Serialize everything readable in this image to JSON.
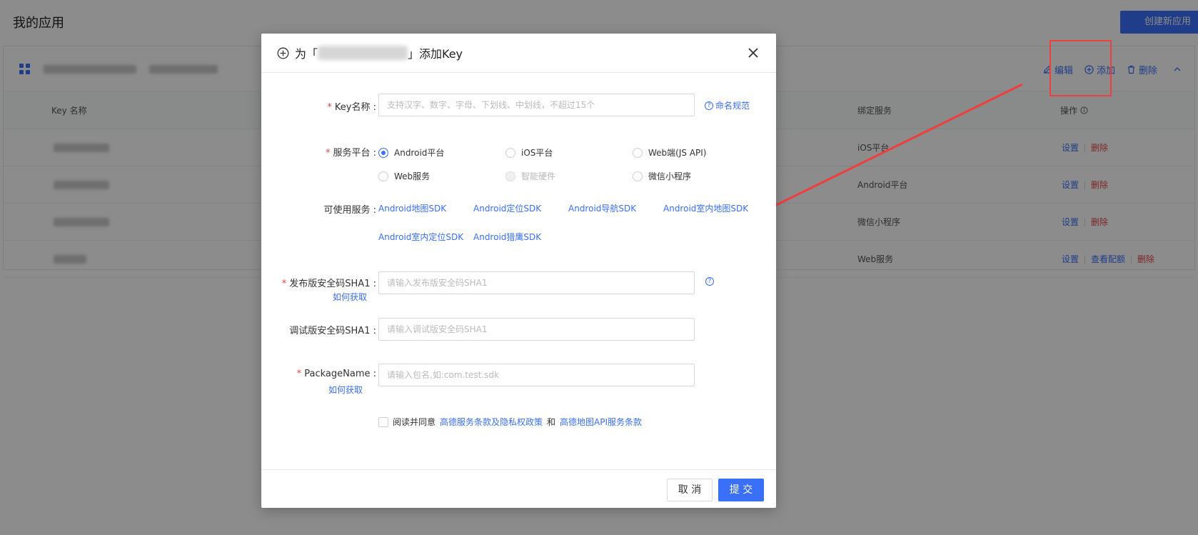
{
  "page": {
    "title": "我的应用",
    "create_button": "创建新应用",
    "app_actions": {
      "edit": "编辑",
      "add": "添加",
      "delete": "删除"
    },
    "table": {
      "headers": {
        "key_name": "Key 名称",
        "bound_service": "绑定服务",
        "operation": "操作"
      },
      "rows": [
        {
          "service": "iOS平台",
          "actions": [
            "设置",
            "删除"
          ]
        },
        {
          "service": "Android平台",
          "actions": [
            "设置",
            "删除"
          ]
        },
        {
          "service": "微信小程序",
          "actions": [
            "设置",
            "删除"
          ]
        },
        {
          "service": "Web服务",
          "actions": [
            "设置",
            "查看配额",
            "删除"
          ]
        }
      ]
    }
  },
  "modal": {
    "title_prefix": "为「",
    "title_suffix": "」添加Key",
    "key_name": {
      "label": "Key名称 :",
      "placeholder": "支持汉字、数字、字母、下划线、中划线，不超过15个",
      "help": "命名规范"
    },
    "platform": {
      "label": "服务平台 :",
      "options": [
        {
          "label": "Android平台",
          "state": "checked"
        },
        {
          "label": "iOS平台",
          "state": "normal"
        },
        {
          "label": "Web端(JS API)",
          "state": "normal"
        },
        {
          "label": "Web服务",
          "state": "normal"
        },
        {
          "label": "智能硬件",
          "state": "disabled"
        },
        {
          "label": "微信小程序",
          "state": "normal"
        }
      ]
    },
    "services": {
      "label": "可使用服务 :",
      "items": [
        "Android地图SDK",
        "Android定位SDK",
        "Android导航SDK",
        "Android室内地图SDK",
        "Android室内定位SDK",
        "Android猎鹰SDK"
      ]
    },
    "release_sha1": {
      "label": "发布版安全码SHA1 :",
      "sub_link": "如何获取",
      "placeholder": "请输入发布版安全码SHA1"
    },
    "debug_sha1": {
      "label": "调试版安全码SHA1 :",
      "placeholder": "请输入调试版安全码SHA1"
    },
    "package_name": {
      "label": "PackageName :",
      "sub_link": "如何获取",
      "placeholder": "请输入包名,如:com.test.sdk"
    },
    "agreement": {
      "prefix": "阅读并同意",
      "link1": "高德服务条款及隐私权政策",
      "middle": "和",
      "link2": "高德地图API服务条款"
    },
    "cancel": "取 消",
    "submit": "提 交"
  },
  "colors": {
    "accent": "#3a6ff7",
    "danger": "#e54545",
    "annotation": "#ee3e3e"
  },
  "icons": [
    "grid-icon",
    "edit-icon",
    "add-circle-icon",
    "trash-icon",
    "chevron-up-icon",
    "info-icon",
    "close-icon",
    "question-icon"
  ]
}
